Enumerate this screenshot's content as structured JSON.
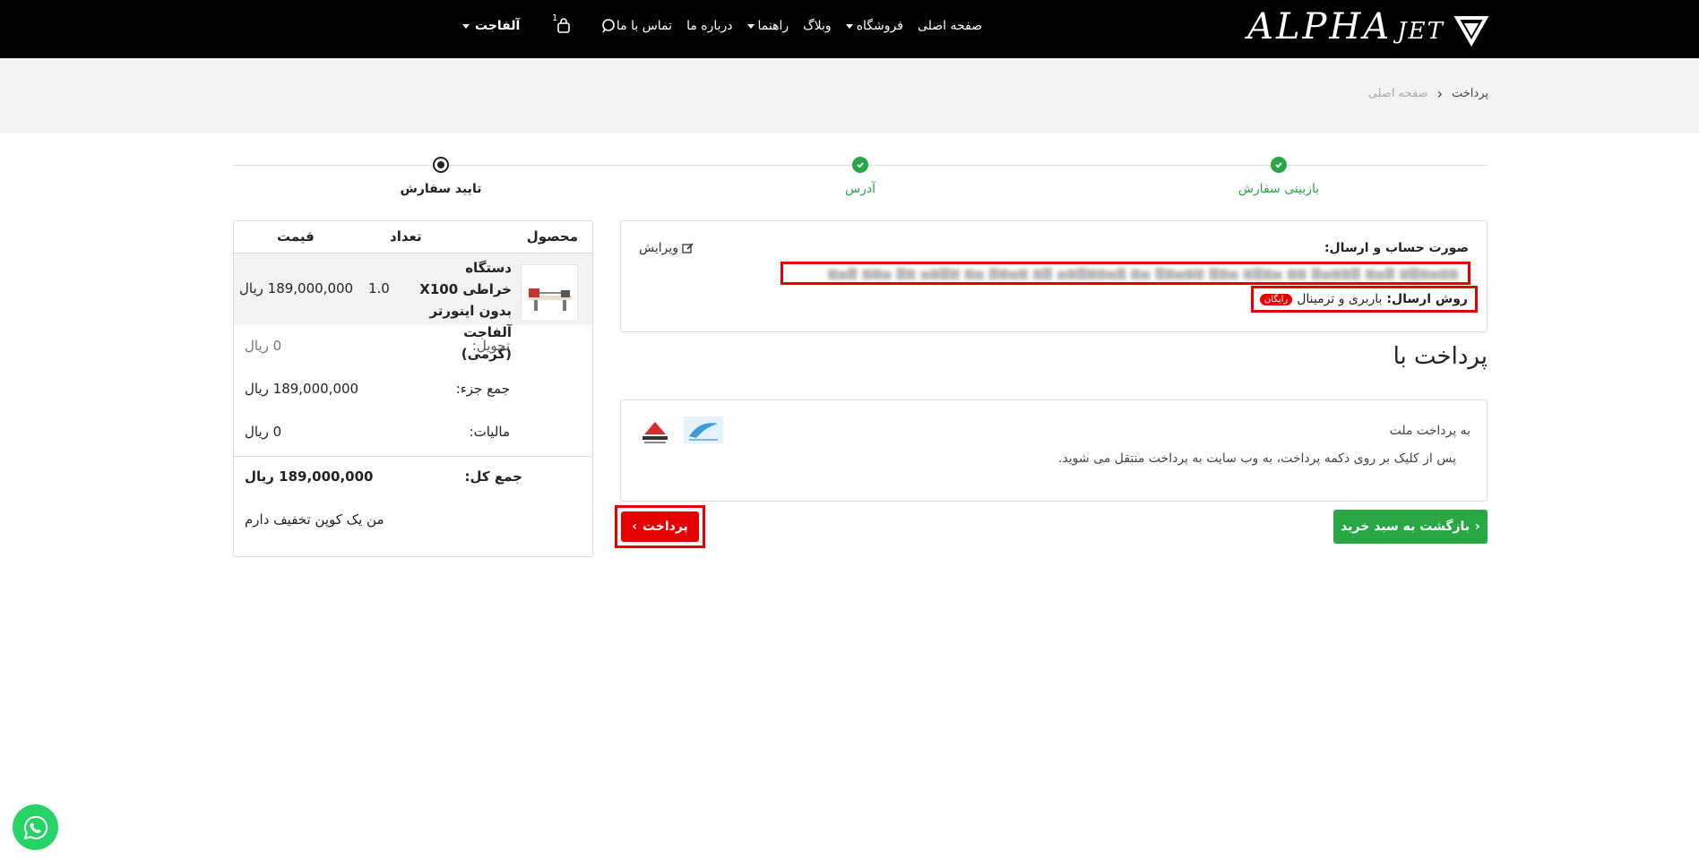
{
  "header": {
    "logo_text": "ALPHA",
    "logo_suffix": "JET",
    "nav": {
      "home": "صفحه اصلی",
      "shop": "فروشگاه",
      "blog": "وبلاگ",
      "guides": "راهنما",
      "about": "درباره ما",
      "contact": "تماس با ما"
    },
    "cart_count": "1",
    "user_menu": "آلفاجت"
  },
  "breadcrumb": {
    "home": "صفحه اصلی",
    "current": "پرداخت"
  },
  "steps": [
    {
      "label": "بازبینی سفارش",
      "status": "done"
    },
    {
      "label": "آدرس",
      "status": "done"
    },
    {
      "label": "تایید سفارش",
      "status": "current"
    }
  ],
  "address_box": {
    "title": "صورت حساب و ارسال:",
    "edit": "ویرایش",
    "shipping_label": "روش ارسال:",
    "shipping_value": "باربری و ترمینال",
    "free_badge": "رایگان"
  },
  "payment": {
    "heading": "پرداخت با",
    "method": "به پرداخت ملت",
    "note": "پس از کلیک بر روی دکمه پرداخت، به وب سایت به پرداخت منتقل می شوید.",
    "back_button": "بازگشت به سبد خرید",
    "pay_button": "پرداخت"
  },
  "summary": {
    "col_product": "محصول",
    "col_qty": "تعداد",
    "col_price": "قیمت",
    "item": {
      "name": "دستگاه خراطی X100 بدون اینورتر آلفاجت (کرمی)",
      "qty": "1.0",
      "price": "189,000,000 ریال"
    },
    "delivery_label": "تحویل:",
    "delivery_value": "0 ریال",
    "subtotal_label": "جمع جزء:",
    "subtotal_value": "189,000,000 ریال",
    "tax_label": "مالیات:",
    "tax_value": "0 ریال",
    "total_label": "جمع کل:",
    "total_value": "189,000,000 ریال",
    "coupon": "من یک کوپن تخفیف دارم"
  },
  "colors": {
    "accent_green": "#28a745",
    "highlight_red": "#e60000",
    "header_bg": "#000000"
  }
}
